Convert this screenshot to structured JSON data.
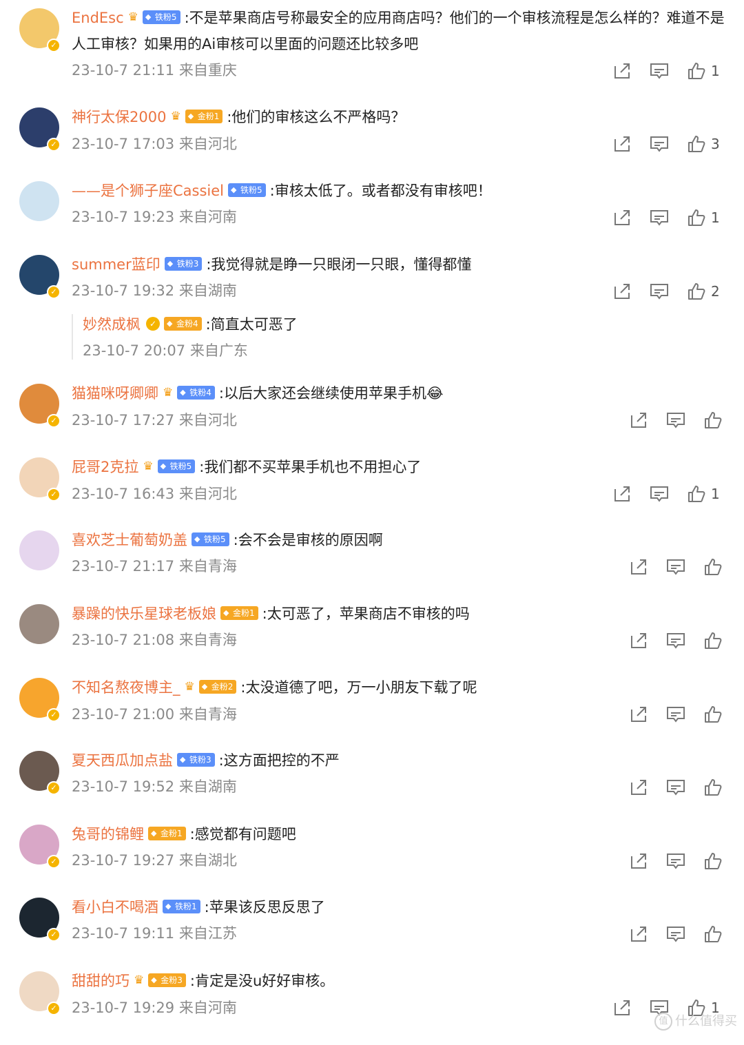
{
  "comments": [
    {
      "name": "EndEsc",
      "fan": "铁粉5",
      "fan_type": "iron",
      "crown": true,
      "text": ":不是苹果商店号称最安全的应用商店吗？他们的一个审核流程是怎么样的？难道不是人工审核？如果用的Ai审核可以里面的问题还比较多吧",
      "time": "23-10-7 21:11",
      "loc": "来自重庆",
      "likes": "1",
      "avatar_color": "#f3c86b"
    },
    {
      "name": "神行太保2000",
      "fan": "金粉1",
      "fan_type": "gold",
      "crown": true,
      "text": ":他们的审核这么不严格吗？",
      "time": "23-10-7 17:03",
      "loc": "来自河北",
      "likes": "3",
      "avatar_color": "#2c3e6b"
    },
    {
      "name": "——是个狮子座Cassiel",
      "fan": "铁粉5",
      "fan_type": "iron",
      "crown": false,
      "text": ":审核太低了。或者都没有审核吧！",
      "time": "23-10-7 19:23",
      "loc": "来自河南",
      "likes": "1",
      "avatar_color": "#cfe3f1"
    },
    {
      "name": "summer蓝印",
      "fan": "铁粉3",
      "fan_type": "iron",
      "crown": false,
      "text": ":我觉得就是睁一只眼闭一只眼，懂得都懂",
      "time": "23-10-7 19:32",
      "loc": "来自湖南",
      "likes": "2",
      "avatar_color": "#24466b"
    },
    {
      "name": "猫猫咪呀卿卿",
      "fan": "铁粉4",
      "fan_type": "iron",
      "crown": true,
      "text": ":以后大家还会继续使用苹果手机",
      "emoji": "😂",
      "time": "23-10-7 17:27",
      "loc": "来自河北",
      "likes": "",
      "avatar_color": "#e08b3c"
    },
    {
      "name": "屁哥2克拉",
      "fan": "铁粉5",
      "fan_type": "iron",
      "crown": true,
      "text": ":我们都不买苹果手机也不用担心了",
      "time": "23-10-7 16:43",
      "loc": "来自河北",
      "likes": "1",
      "avatar_color": "#f2d5b8"
    },
    {
      "name": "喜欢芝士葡萄奶盖",
      "fan": "铁粉5",
      "fan_type": "iron",
      "crown": false,
      "text": ":会不会是审核的原因啊",
      "time": "23-10-7 21:17",
      "loc": "来自青海",
      "likes": "",
      "avatar_color": "#e6d6ee"
    },
    {
      "name": "暴躁的快乐星球老板娘",
      "fan": "金粉1",
      "fan_type": "gold",
      "crown": false,
      "text": ":太可恶了，苹果商店不审核的吗",
      "time": "23-10-7 21:08",
      "loc": "来自青海",
      "likes": "",
      "avatar_color": "#9a8a80"
    },
    {
      "name": "不知名熬夜博主_",
      "fan": "金粉2",
      "fan_type": "gold",
      "crown": true,
      "text": ":太没道德了吧，万一小朋友下载了呢",
      "time": "23-10-7 21:00",
      "loc": "来自青海",
      "likes": "",
      "avatar_color": "#f7a52d"
    },
    {
      "name": "夏天西瓜加点盐",
      "fan": "铁粉3",
      "fan_type": "iron",
      "crown": false,
      "text": ":这方面把控的不严",
      "time": "23-10-7 19:52",
      "loc": "来自湖南",
      "likes": "",
      "avatar_color": "#6b5a50"
    },
    {
      "name": "兔哥的锦鲤",
      "fan": "金粉1",
      "fan_type": "gold",
      "crown": false,
      "text": ":感觉都有问题吧",
      "time": "23-10-7 19:27",
      "loc": "来自湖北",
      "likes": "",
      "avatar_color": "#d9a7c7"
    },
    {
      "name": "看小白不喝酒",
      "fan": "铁粉1",
      "fan_type": "iron",
      "crown": false,
      "text": ":苹果该反思反思了",
      "time": "23-10-7 19:11",
      "loc": "来自江苏",
      "likes": "",
      "avatar_color": "#1c2630"
    },
    {
      "name": "甜甜的巧",
      "fan": "金粉3",
      "fan_type": "gold",
      "crown": true,
      "text": ":肯定是没u好好审核。",
      "time": "23-10-7 19:29",
      "loc": "来自河南",
      "likes": "1",
      "avatar_color": "#efd9c4"
    }
  ],
  "reply": {
    "name": "妙然成枫",
    "fan": "金粉4",
    "text": ":简直太可恶了",
    "time": "23-10-7 20:07",
    "loc": "来自广东"
  },
  "watermark": "什么值得买",
  "watermark_icon": "值"
}
